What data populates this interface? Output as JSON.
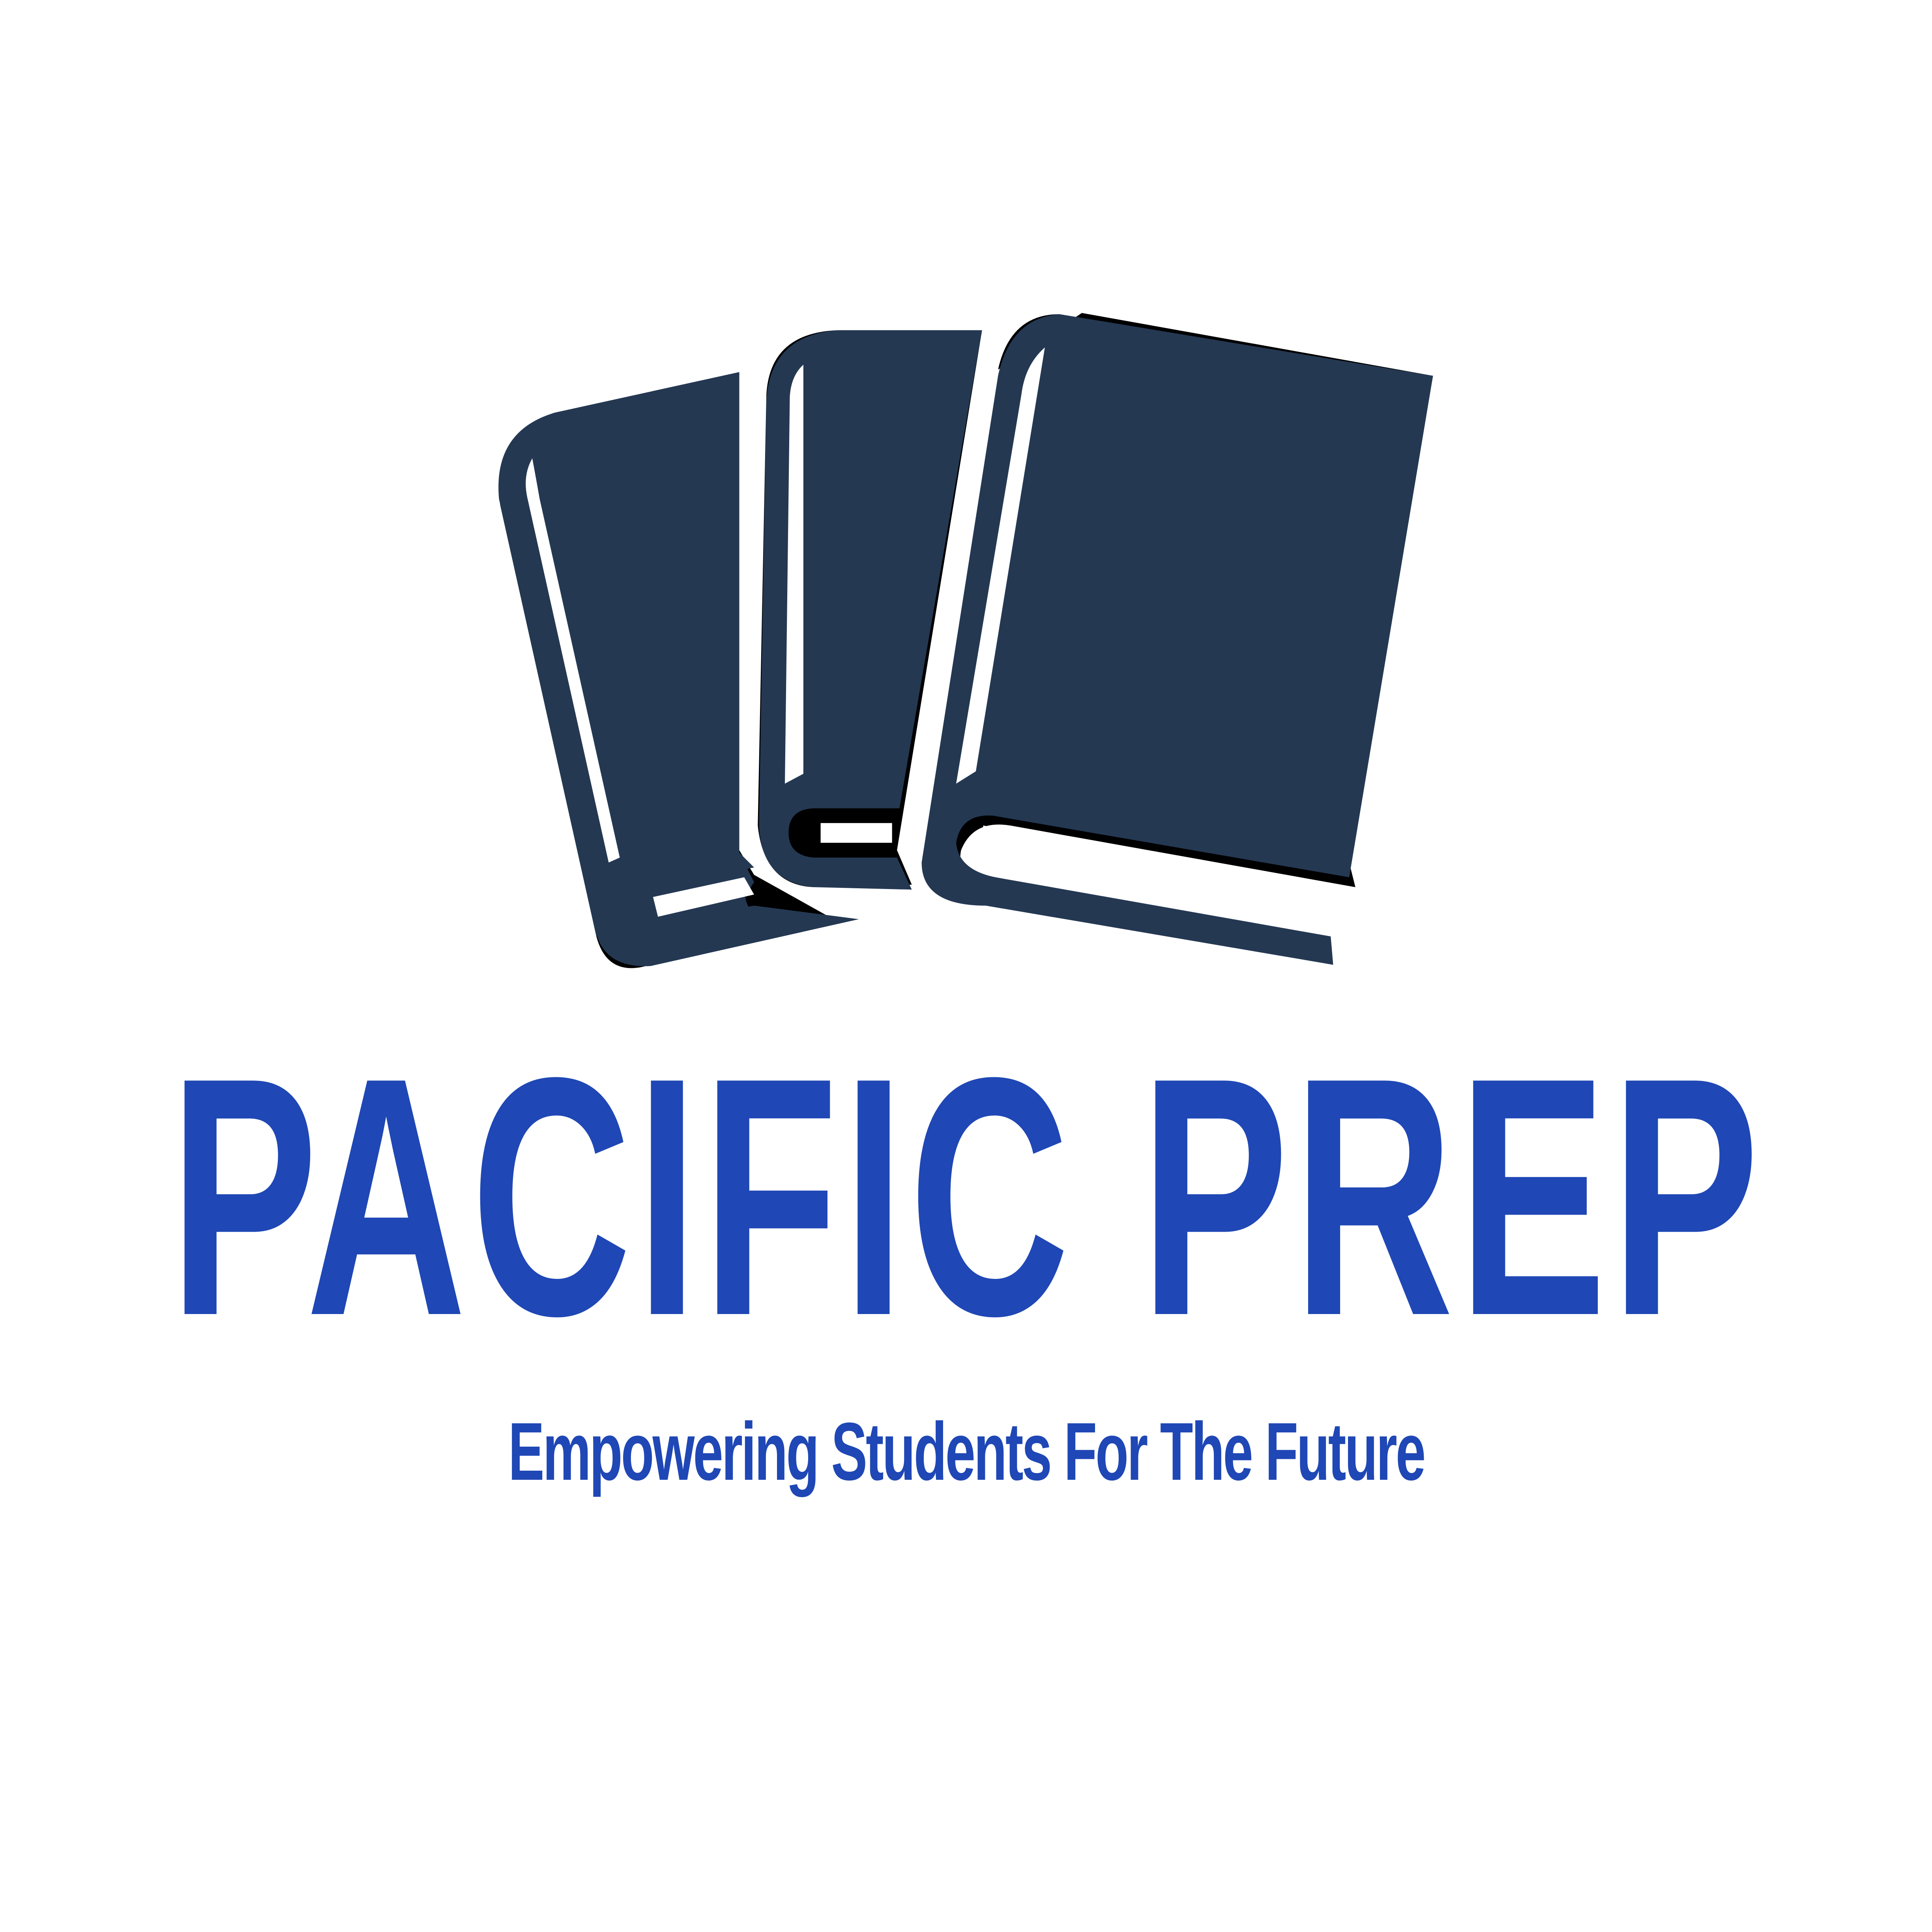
{
  "brand": {
    "name": "PACIFIC PREP",
    "tagline": "Empowering Students For The Future"
  },
  "icons": {
    "logo": "stacked-books-icon"
  },
  "colors": {
    "background": "#ffffff",
    "books": "#243852",
    "brand_blue": "#1f47b5"
  }
}
